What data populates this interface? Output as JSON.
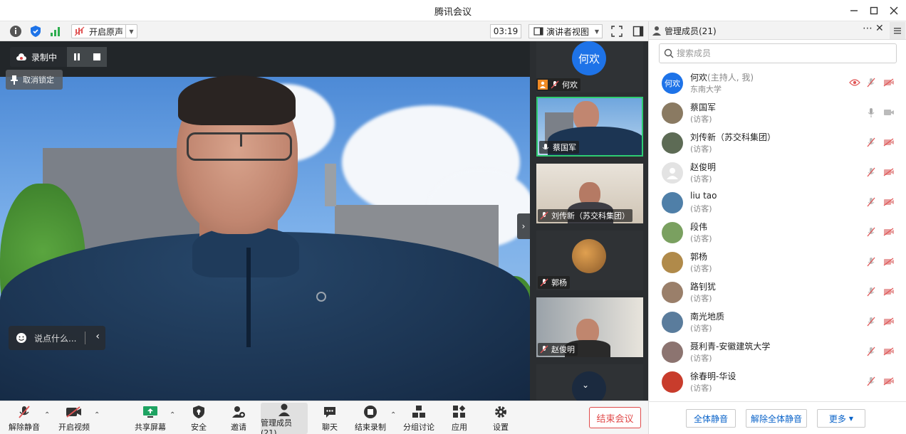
{
  "window": {
    "title": "腾讯会议"
  },
  "topbar": {
    "audio_label": "开启原声",
    "timer": "03:19",
    "view_label": "演讲者视图"
  },
  "stage": {
    "recording_label": "录制中",
    "unpin_label": "取消锁定",
    "chat_placeholder": "说点什么..."
  },
  "thumbnails": [
    {
      "name": "何欢",
      "avatar_text": "何欢"
    },
    {
      "name": "蔡国军"
    },
    {
      "name": "刘传新（苏交科集团）"
    },
    {
      "name": "郭杨"
    },
    {
      "name": "赵俊明"
    }
  ],
  "panel": {
    "title": "管理成员(21)",
    "search_placeholder": "搜索成员",
    "members": [
      {
        "name": "何欢",
        "role": "(主持人, 我)",
        "sub": "东南大学",
        "avatar_text": "何欢",
        "avatar_color": "#1e73e8"
      },
      {
        "name": "蔡国军",
        "role": "",
        "sub": "(访客)",
        "avatar_color": "#8a7a62"
      },
      {
        "name": "刘传新（苏交科集团）",
        "role": "",
        "sub": "(访客)",
        "avatar_color": "#5d6b55"
      },
      {
        "name": "赵俊明",
        "role": "",
        "sub": "(访客)",
        "avatar_color": "#e3e3e3"
      },
      {
        "name": "liu tao",
        "role": "",
        "sub": "(访客)",
        "avatar_color": "#4f7fa8"
      },
      {
        "name": "段伟",
        "role": "",
        "sub": "(访客)",
        "avatar_color": "#7aa060"
      },
      {
        "name": "郭杨",
        "role": "",
        "sub": "(访客)",
        "avatar_color": "#b08a4a"
      },
      {
        "name": "路钊犹",
        "role": "",
        "sub": "(访客)",
        "avatar_color": "#9a7f6a"
      },
      {
        "name": "南光地质",
        "role": "",
        "sub": "(访客)",
        "avatar_color": "#5a7c9c"
      },
      {
        "name": "聂利青-安徽建筑大学",
        "role": "",
        "sub": "(访客)",
        "avatar_color": "#8c7470"
      },
      {
        "name": "徐春明-华设",
        "role": "",
        "sub": "(访客)",
        "avatar_color": "#c83c2c"
      }
    ],
    "footer": {
      "mute_all": "全体静音",
      "unmute_all": "解除全体静音",
      "more": "更多"
    }
  },
  "bottombar": {
    "unmute": "解除静音",
    "start_video": "开启视频",
    "share_screen": "共享屏幕",
    "security": "安全",
    "invite": "邀请",
    "manage_members": "管理成员(21)",
    "chat": "聊天",
    "stop_recording": "结束录制",
    "breakout": "分组讨论",
    "apps": "应用",
    "settings": "设置",
    "end_meeting": "结束会议"
  },
  "colors": {
    "accent_blue": "#1e73e8",
    "end_red": "#e04a4a",
    "muted_red": "#e05555"
  }
}
